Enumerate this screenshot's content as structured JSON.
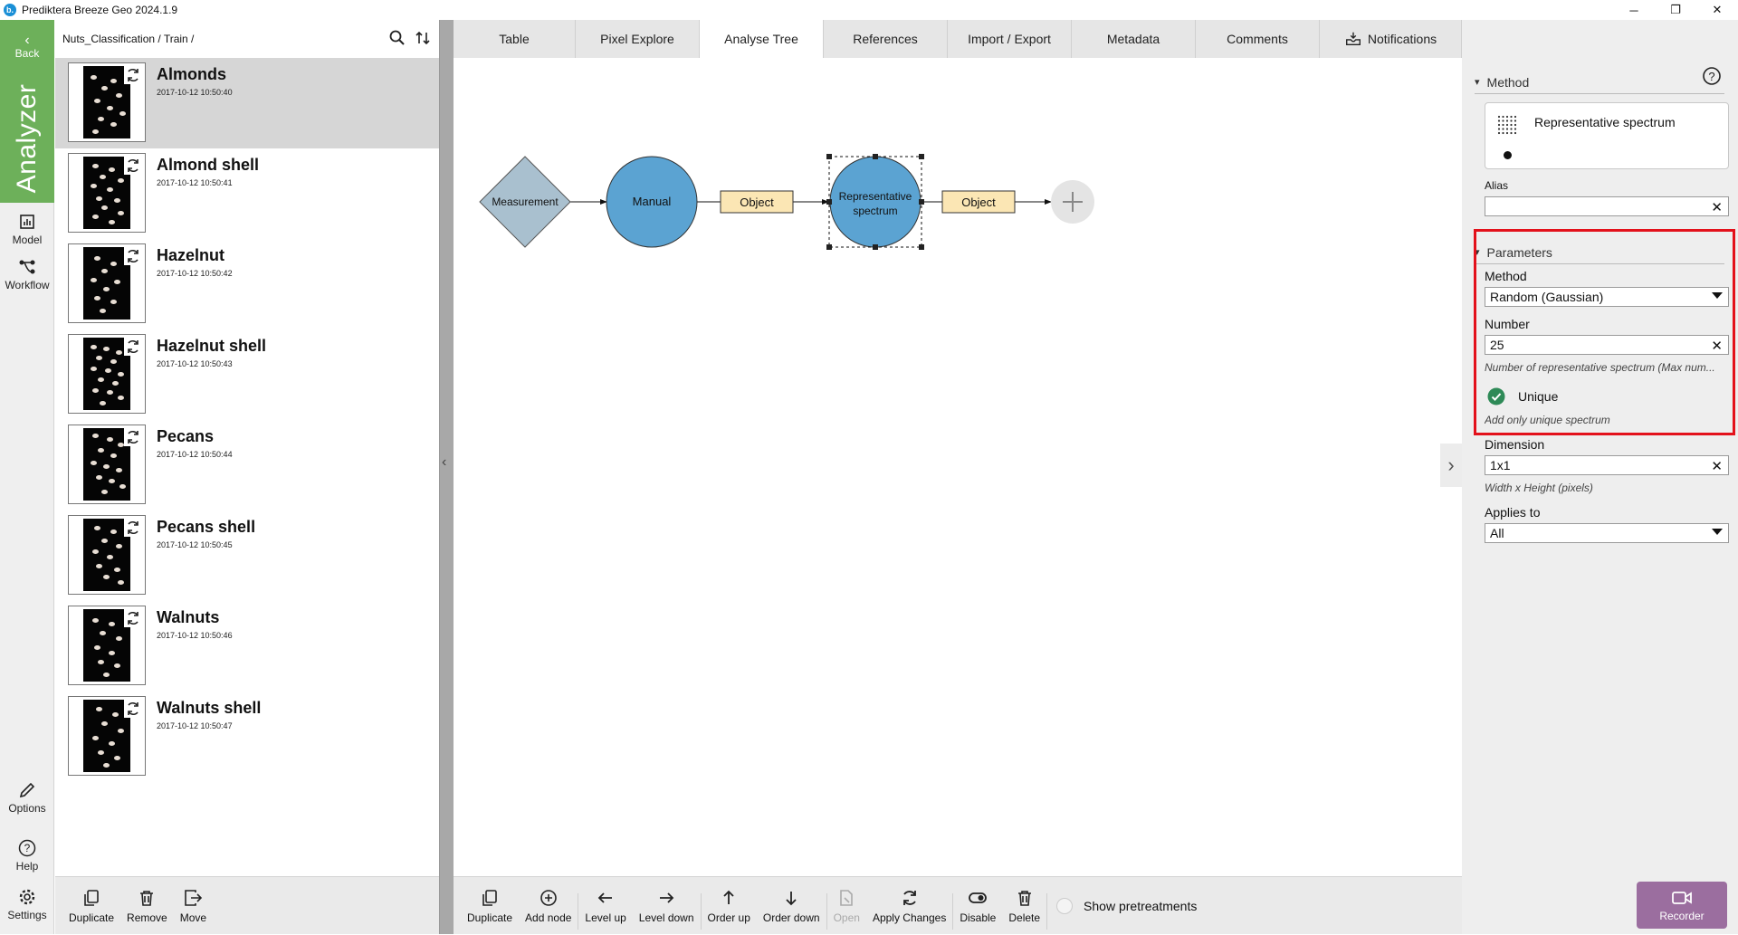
{
  "window": {
    "title": "Prediktera Breeze Geo 2024.1.9",
    "logo_letter": "b.",
    "minimize": "─",
    "maximize": "❐",
    "close": "✕"
  },
  "rail": {
    "back_label": "Back",
    "analyzer_label": "Analyzer",
    "model_label": "Model",
    "workflow_label": "Workflow",
    "options_label": "Options",
    "help_label": "Help",
    "settings_label": "Settings"
  },
  "samples": {
    "breadcrumb": "Nuts_Classification / Train /",
    "items": [
      {
        "name": "Almonds",
        "timestamp": "2017-10-12 10:50:40",
        "selected": true
      },
      {
        "name": "Almond shell",
        "timestamp": "2017-10-12 10:50:41",
        "selected": false
      },
      {
        "name": "Hazelnut",
        "timestamp": "2017-10-12 10:50:42",
        "selected": false
      },
      {
        "name": "Hazelnut shell",
        "timestamp": "2017-10-12 10:50:43",
        "selected": false
      },
      {
        "name": "Pecans",
        "timestamp": "2017-10-12 10:50:44",
        "selected": false
      },
      {
        "name": "Pecans shell",
        "timestamp": "2017-10-12 10:50:45",
        "selected": false
      },
      {
        "name": "Walnuts",
        "timestamp": "2017-10-12 10:50:46",
        "selected": false
      },
      {
        "name": "Walnuts shell",
        "timestamp": "2017-10-12 10:50:47",
        "selected": false
      }
    ],
    "toolbar": {
      "duplicate": "Duplicate",
      "remove": "Remove",
      "move": "Move"
    }
  },
  "tabs": [
    {
      "label": "Table",
      "active": false
    },
    {
      "label": "Pixel Explore",
      "active": false
    },
    {
      "label": "Analyse Tree",
      "active": true
    },
    {
      "label": "References",
      "active": false
    },
    {
      "label": "Import / Export",
      "active": false
    },
    {
      "label": "Metadata",
      "active": false
    },
    {
      "label": "Comments",
      "active": false
    },
    {
      "label": "Notifications",
      "active": false
    }
  ],
  "tree": {
    "measurement": "Measurement",
    "manual": "Manual",
    "object1": "Object",
    "rep_line1": "Representative",
    "rep_line2": "spectrum",
    "object2": "Object",
    "colors": {
      "diamond": "#a9c0cf",
      "circle": "#5ba3d2",
      "object": "#fbe6b4"
    }
  },
  "canvas_toolbar": {
    "duplicate": "Duplicate",
    "add_node": "Add node",
    "level_up": "Level up",
    "level_down": "Level down",
    "order_up": "Order up",
    "order_down": "Order down",
    "open": "Open",
    "apply_changes": "Apply Changes",
    "disable": "Disable",
    "delete": "Delete",
    "show_pretreatments": "Show pretreatments"
  },
  "props": {
    "method_section": "Method",
    "method_card_title": "Representative spectrum",
    "alias_label": "Alias",
    "alias_value": "",
    "parameters_section": "Parameters",
    "param_method_label": "Method",
    "param_method_value": "Random (Gaussian)",
    "number_label": "Number",
    "number_value": "25",
    "number_hint": "Number of representative spectrum (Max num...",
    "unique_label": "Unique",
    "unique_hint": "Add only unique spectrum",
    "dimension_label": "Dimension",
    "dimension_value": "1x1",
    "dimension_hint": "Width x Height (pixels)",
    "applies_label": "Applies to",
    "applies_value": "All",
    "highlight_color": "#e3111b"
  },
  "recorder_label": "Recorder"
}
